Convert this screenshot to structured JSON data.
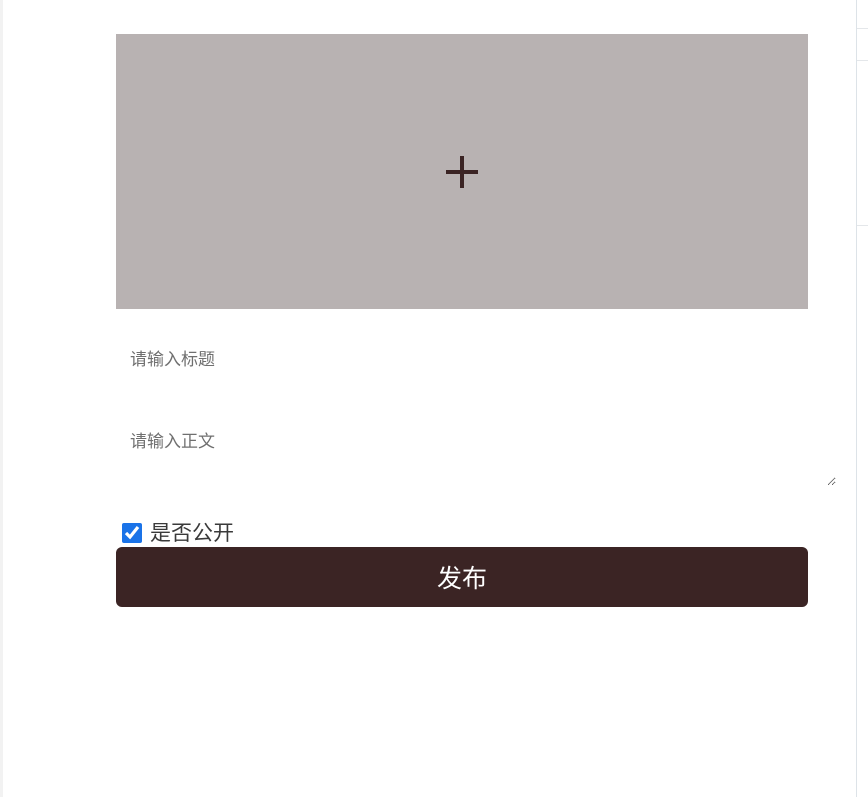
{
  "upload": {
    "icon": "plus-icon",
    "background_color": "#b8b2b2",
    "icon_color": "#3b2424"
  },
  "form": {
    "title_placeholder": "请输入标题",
    "body_placeholder": "请输入正文",
    "public_checkbox_label": "是否公开",
    "public_checked": true,
    "publish_label": "发布",
    "publish_button_color": "#3b2424"
  }
}
